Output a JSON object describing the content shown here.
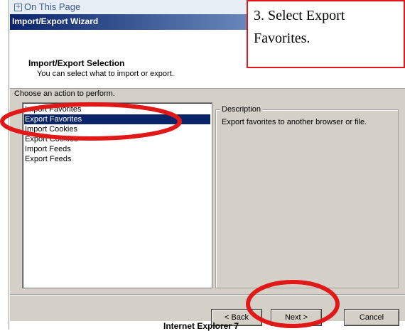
{
  "page_nav": {
    "label": "On This Page",
    "expander": "+"
  },
  "dialog": {
    "title": "Import/Export Wizard",
    "header_title": "Import/Export Selection",
    "header_subtitle": "You can select what to import or export.",
    "choose_label": "Choose an action to perform.",
    "actions": [
      "Import Favorites",
      "Export Favorites",
      "Import Cookies",
      "Export Cookies",
      "Import Feeds",
      "Export Feeds"
    ],
    "selected_action": "Export Favorites",
    "description_label": "Description",
    "description_text": "Export favorites to another browser or file.",
    "buttons": {
      "back": "< Back",
      "next": "Next >",
      "cancel": "Cancel"
    }
  },
  "footer_text": "Internet Explorer 7",
  "callout": {
    "line1": "3.  Select Export",
    "line2": "Favorites."
  },
  "colors": {
    "annotation": "#e01818",
    "title_bar": "#0a246a",
    "selection": "#0a246a",
    "dialog_bg": "#d4d0c8"
  }
}
